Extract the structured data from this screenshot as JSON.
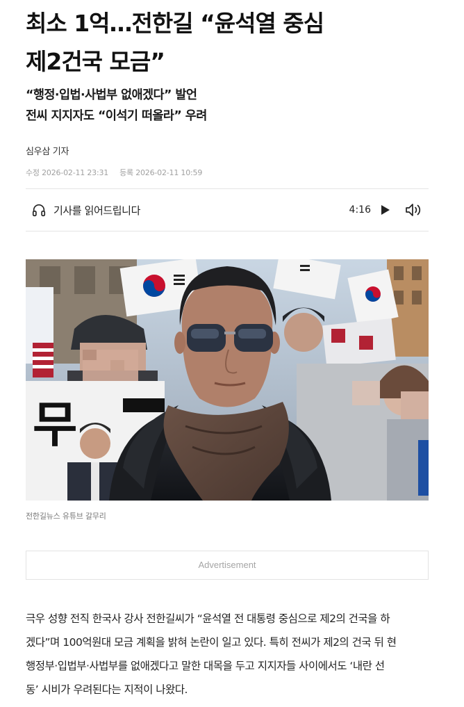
{
  "article": {
    "headline_line1": "최소 1억…전한길 “윤석열 중심",
    "headline_line2": "제2건국 모금”",
    "subhead_line1": "“행정·입법·사법부 없애겠다” 발언",
    "subhead_line2": "전씨 지지자도 “이석기 떠올라” 우려",
    "byline": "심우삼 기자",
    "modified": "수정 2026-02-11 23:31",
    "registered": "등록 2026-02-11 10:59"
  },
  "tts": {
    "label": "기사를 읽어드립니다",
    "duration": "4:16",
    "icons": [
      "headphone-icon",
      "play-icon",
      "volume-icon"
    ]
  },
  "photo": {
    "caption": "전한길뉴스 유튜브 갈무리",
    "sign_text": "무"
  },
  "ad": {
    "label": "Advertisement"
  },
  "body": {
    "line1": "극우 성향 전직 한국사 강사 전한길씨가 “윤석열 전 대통령 중심으로 제2의 건국을 하",
    "line2": "겠다”며 100억원대 모금 계획을 밝혀 논란이 일고 있다. 특히 전씨가 제2의 건국 뒤 현",
    "line3": "행정부·입법부·사법부를 없애겠다고 말한 대목을 두고 지지자들 사이에서도 ‘내란 선",
    "line4": "동’ 시비가 우려된다는 지적이 나왔다."
  },
  "colors": {
    "text": "#111111",
    "meta": "#a0a0a0",
    "divider": "#e4e4e4"
  }
}
